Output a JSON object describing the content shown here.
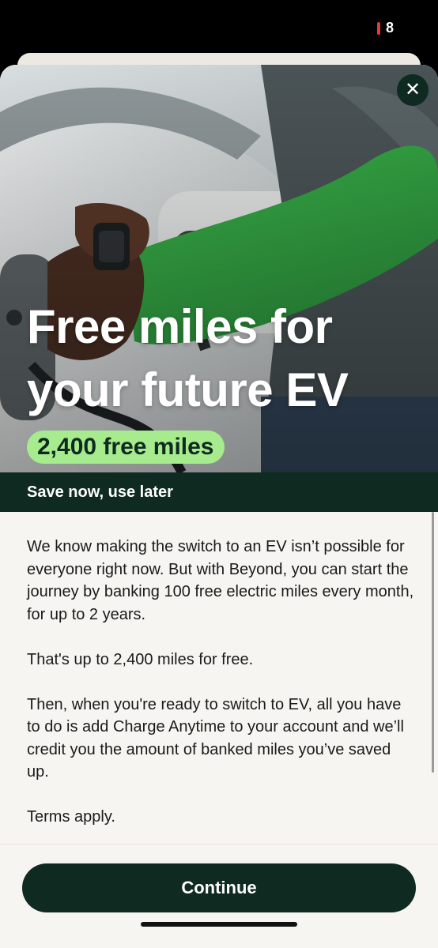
{
  "status_bar": {
    "battery_text": "8",
    "battery_color": "#e23b3b"
  },
  "hero": {
    "title_line1": "Free miles for",
    "title_line2": "your future EV",
    "badge": "2,400 free miles",
    "badge_color": "#a6eb8d",
    "close_icon": "close-icon"
  },
  "subheader": {
    "text": "Save now, use later"
  },
  "body": {
    "paragraphs": [
      "We know making the switch to an EV isn’t possible for everyone right now. But with Beyond, you can start the journey by banking 100 free electric miles every month, for up to 2 years.",
      "That's up to 2,400 miles for free.",
      "Then, when you're ready to switch to EV, all you have to do is add Charge Anytime to your account and we’ll credit you the amount of banked miles you’ve saved up.",
      "Terms apply."
    ]
  },
  "footer": {
    "continue_label": "Continue"
  },
  "colors": {
    "brand_dark": "#0f2a20",
    "background": "#f7f5f1",
    "accent_green": "#a6eb8d"
  }
}
